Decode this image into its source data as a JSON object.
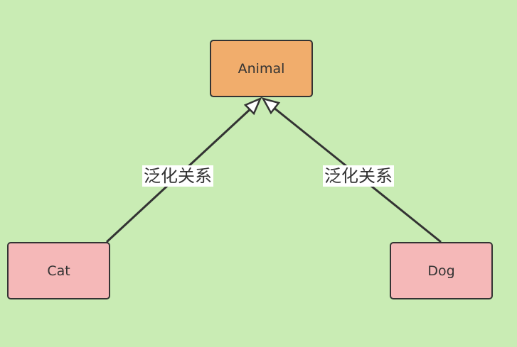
{
  "colors": {
    "background": "#c9ecb4",
    "parent_fill": "#f1ad6c",
    "child_fill": "#f5b8b8",
    "stroke": "#333333"
  },
  "nodes": {
    "animal": {
      "label": "Animal"
    },
    "cat": {
      "label": "Cat"
    },
    "dog": {
      "label": "Dog"
    }
  },
  "edges": [
    {
      "from": "Cat",
      "to": "Animal",
      "type": "generalization",
      "label": "泛化关系"
    },
    {
      "from": "Dog",
      "to": "Animal",
      "type": "generalization",
      "label": "泛化关系"
    }
  ]
}
